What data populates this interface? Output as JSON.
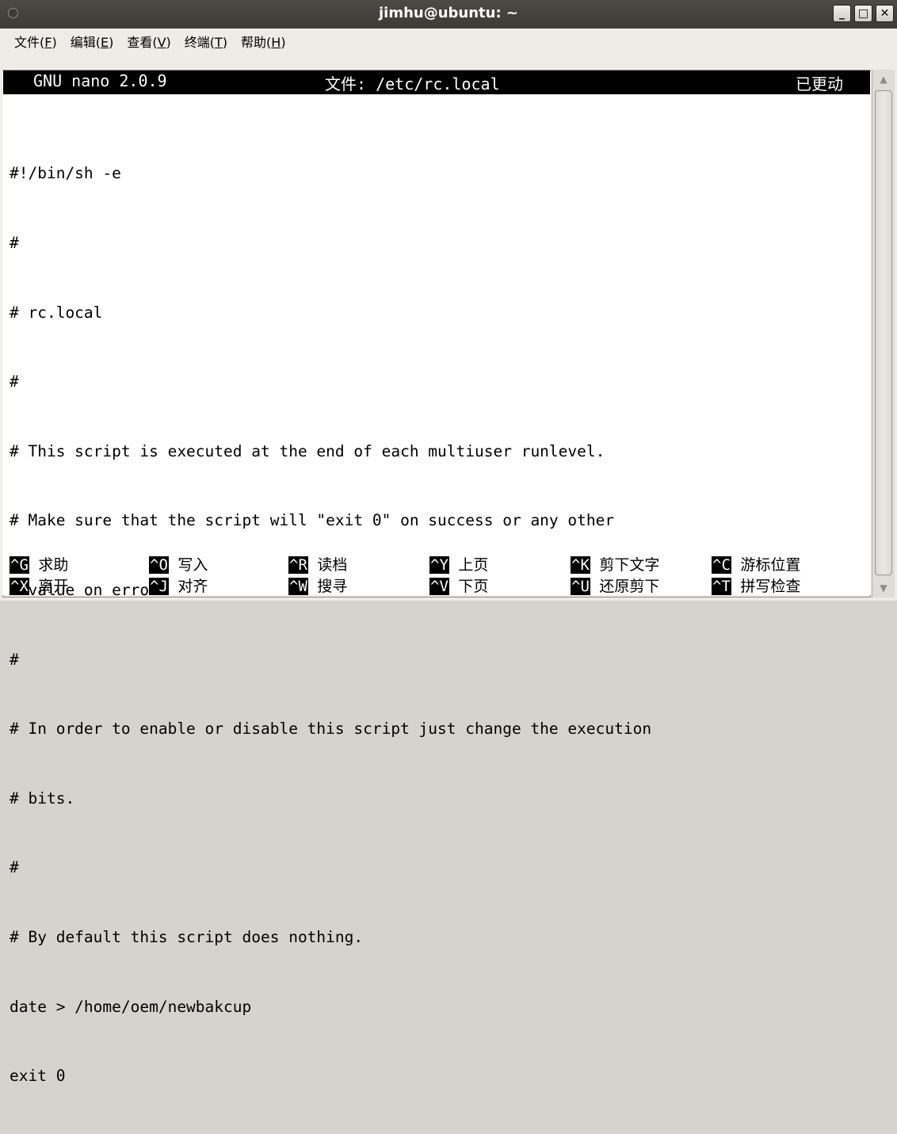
{
  "window": {
    "title": "jimhu@ubuntu: ~",
    "buttons": [
      "minimize-icon",
      "maximize-icon",
      "close-icon"
    ]
  },
  "menubar": {
    "items": [
      {
        "text": "文件(",
        "key": "F",
        "end": ")"
      },
      {
        "text": "编辑(",
        "key": "E",
        "end": ")"
      },
      {
        "text": "查看(",
        "key": "V",
        "end": ")"
      },
      {
        "text": "终端(",
        "key": "T",
        "end": ")"
      },
      {
        "text": "帮助(",
        "key": "H",
        "end": ")"
      }
    ]
  },
  "nano": {
    "version": "GNU nano 2.0.9",
    "file_label": "文件: /etc/rc.local",
    "status": "已更动"
  },
  "content": {
    "lines": [
      "#!/bin/sh -e",
      "#",
      "# rc.local",
      "#",
      "# This script is executed at the end of each multiuser runlevel.",
      "# Make sure that the script will \"exit 0\" on success or any other",
      "# value on error.",
      "#",
      "# In order to enable or disable this script just change the execution",
      "# bits.",
      "#",
      "# By default this script does nothing.",
      "date > /home/oem/newbakcup",
      "exit 0"
    ]
  },
  "shortcuts": {
    "row1": [
      {
        "key": "^G",
        "label": "求助"
      },
      {
        "key": "^O",
        "label": "写入"
      },
      {
        "key": "^R",
        "label": "读档"
      },
      {
        "key": "^Y",
        "label": "上页"
      },
      {
        "key": "^K",
        "label": "剪下文字"
      },
      {
        "key": "^C",
        "label": "游标位置"
      }
    ],
    "row2": [
      {
        "key": "^X",
        "label": "离开"
      },
      {
        "key": "^J",
        "label": "对齐"
      },
      {
        "key": "^W",
        "label": "搜寻"
      },
      {
        "key": "^V",
        "label": "下页"
      },
      {
        "key": "^U",
        "label": "还原剪下"
      },
      {
        "key": "^T",
        "label": "拼写检查"
      }
    ]
  }
}
